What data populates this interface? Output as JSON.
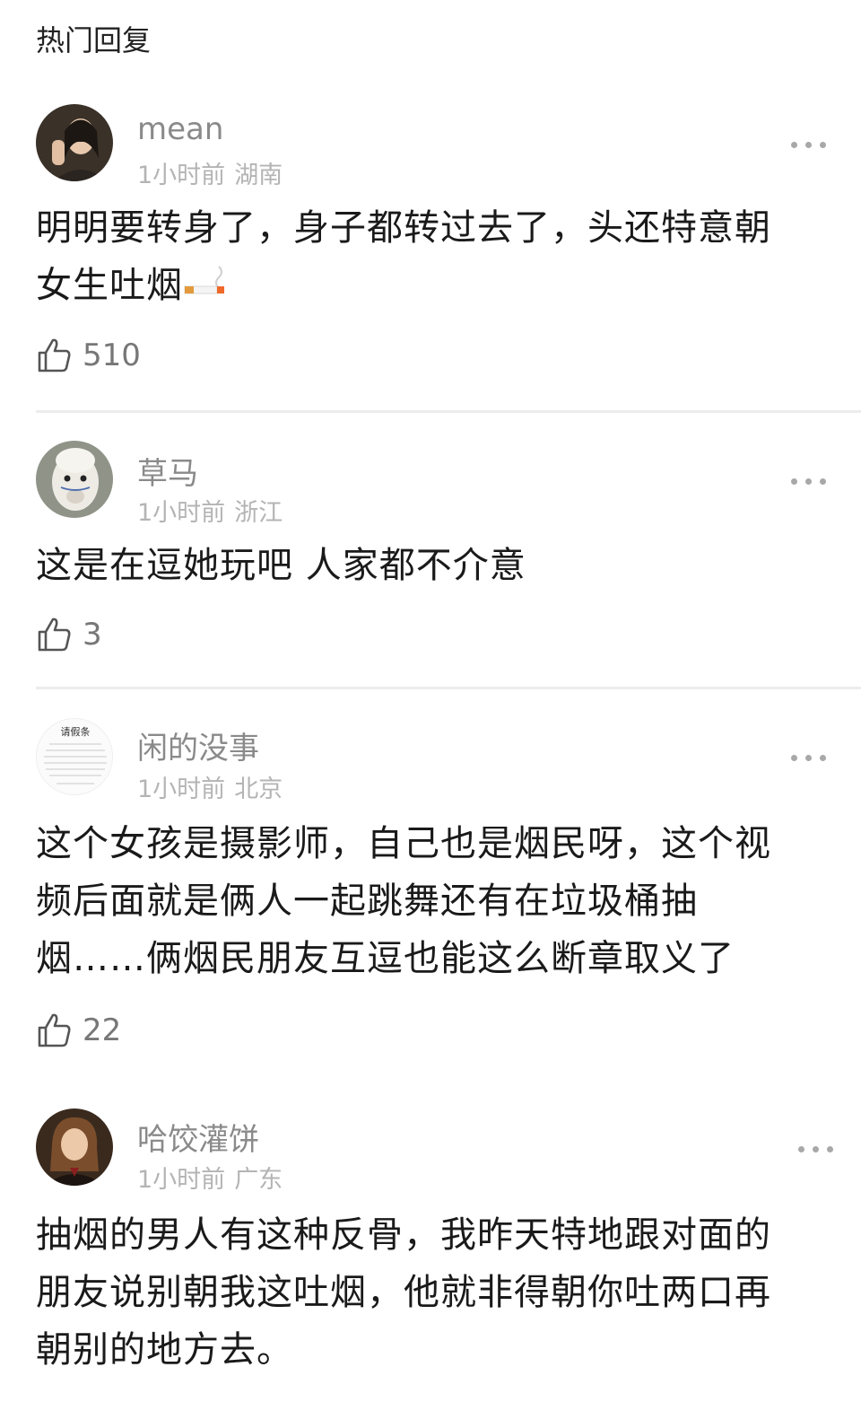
{
  "section": {
    "title": "热门回复"
  },
  "comments": [
    {
      "username": "mean",
      "time": "1小时前",
      "location": "湖南",
      "text_lines": [
        "明明要转身了，身子都转过去了，头还特意朝",
        "女生吐烟"
      ],
      "emoji": "cigarette-emoji",
      "likes": "510"
    },
    {
      "username": "草马",
      "time": "1小时前",
      "location": "浙江",
      "text_lines": [
        "这是在逗她玩吧 人家都不介意"
      ],
      "likes": "3"
    },
    {
      "username": "闲的没事",
      "time": "1小时前",
      "location": "北京",
      "avatar_text": "请假条",
      "text_lines": [
        "这个女孩是摄影师，自己也是烟民呀，这个视",
        "频后面就是俩人一起跳舞还有在垃圾桶抽",
        "烟……俩烟民朋友互逗也能这么断章取义了"
      ],
      "likes": "22"
    },
    {
      "username": "哈饺灌饼",
      "time": "1小时前",
      "location": "广东",
      "text_lines": [
        "抽烟的男人有这种反骨，我昨天特地跟对面的",
        "朋友说别朝我这吐烟，他就非得朝你吐两口再",
        "朝别的地方去。"
      ]
    }
  ],
  "icons": {
    "like": "thumbs-up-icon",
    "more": "more-dots-icon"
  }
}
